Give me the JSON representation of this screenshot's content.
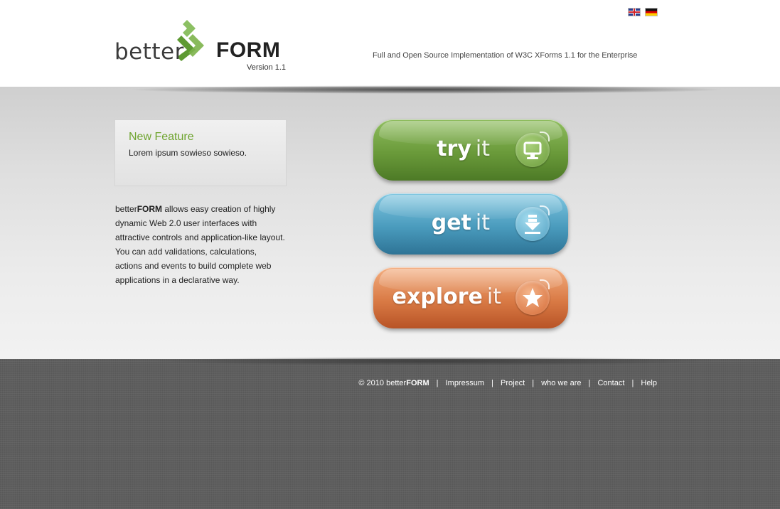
{
  "header": {
    "flags": {
      "english": "english-flag-icon",
      "german": "german-flag-icon"
    },
    "logo": {
      "better": "better",
      "form": "FORM",
      "version": "Version 1.1",
      "mark": "betterform-arrow-logo-icon"
    },
    "tagline": "Full and Open Source Implementation of W3C XForms 1.1 for the Enterprise"
  },
  "feature": {
    "title": "New Feature",
    "text": "Lorem ipsum sowieso sowieso."
  },
  "description": {
    "brand_light": "better",
    "brand_bold": "FORM",
    "text": " allows easy creation of highly dynamic Web 2.0 user interfaces with attractive controls and application-like layout. You can add validations, calculations, actions and events to build complete web applications in a declarative way."
  },
  "buttons": [
    {
      "strong": "try",
      "light": "it",
      "icon": "monitor-icon",
      "color": "#6a9a3a"
    },
    {
      "strong": "get",
      "light": "it",
      "icon": "download-icon",
      "color": "#4a9bbd"
    },
    {
      "strong": "explore",
      "light": "it",
      "icon": "star-icon",
      "color": "#d97a45"
    }
  ],
  "footer": {
    "copyright_prefix": "© 2010 better",
    "copyright_brand": "FORM",
    "separator": "|",
    "links": [
      "Impressum",
      "Project",
      "who we are",
      "Contact",
      "Help"
    ]
  },
  "colors": {
    "accent_green": "#6ea42e",
    "footer_bg": "#5e5e5e",
    "header_bg": "#ffffff"
  }
}
